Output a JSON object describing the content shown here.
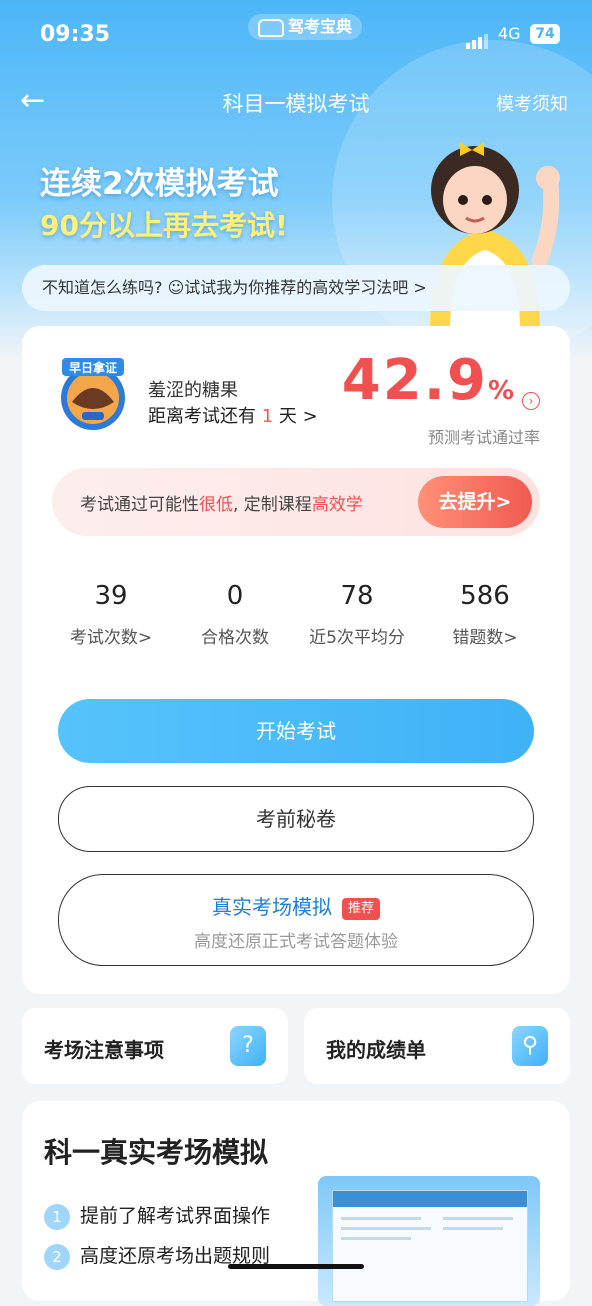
{
  "status_bar": {
    "time": "09:35",
    "brand": "驾考宝典",
    "network": "4G",
    "battery": "74"
  },
  "nav": {
    "title": "科目一模拟考试",
    "right_link": "模考须知"
  },
  "hero": {
    "line1": "连续2次模拟考试",
    "line2": "90分以上再去考试!"
  },
  "tip": {
    "text": "不知道怎么练吗? ☺试试我为你推荐的高效学习法吧 >"
  },
  "profile": {
    "badge": "早日拿证",
    "username": "羞涩的糖果",
    "days_prefix": "距离考试还有",
    "days_value": "1",
    "days_suffix": "天 >"
  },
  "pass_rate": {
    "value": "42.9",
    "unit": "%",
    "label": "预测考试通过率"
  },
  "warning": {
    "text_a": "考试通过可能性",
    "text_b": "很低",
    "text_c": ", 定制课程",
    "text_d": "高效学",
    "button": "去提升>"
  },
  "stats": [
    {
      "value": "39",
      "label": "考试次数>"
    },
    {
      "value": "0",
      "label": "合格次数"
    },
    {
      "value": "78",
      "label": "近5次平均分"
    },
    {
      "value": "586",
      "label": "错题数>"
    }
  ],
  "buttons": {
    "start": "开始考试",
    "secret": "考前秘卷",
    "real_title": "真实考场模拟",
    "real_tag": "推荐",
    "real_sub": "高度还原正式考试答题体验"
  },
  "tiles": [
    {
      "label": "考场注意事项",
      "icon": "question-icon"
    },
    {
      "label": "我的成绩单",
      "icon": "search-doc-icon"
    }
  ],
  "section": {
    "title": "科一真实考场模拟",
    "items": [
      {
        "n": "1",
        "text": "提前了解考试界面操作"
      },
      {
        "n": "2",
        "text": "高度还原考场出题规则"
      }
    ]
  },
  "colors": {
    "accent": "#3fb2f6",
    "danger": "#f0504f",
    "highlight": "#fff07a"
  }
}
